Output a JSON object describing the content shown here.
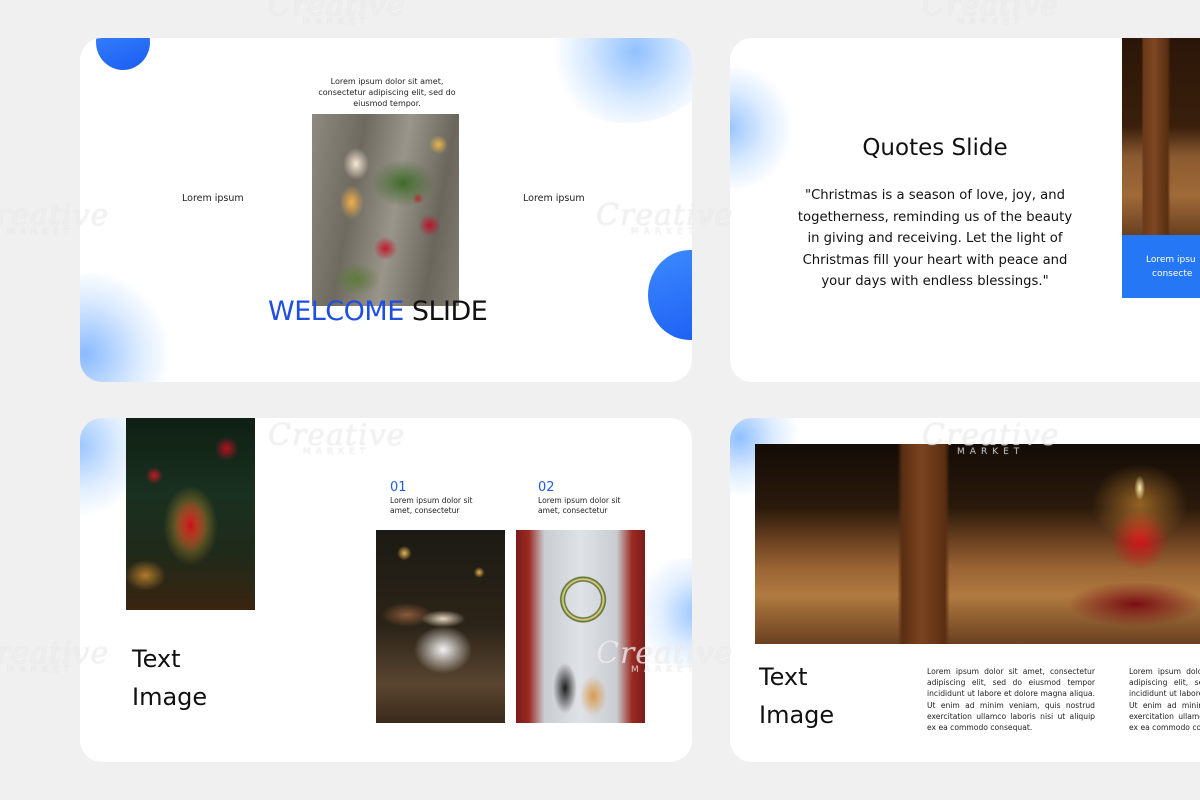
{
  "watermark": {
    "brand": "Creative",
    "sub": "MARKET"
  },
  "slide1": {
    "caption": "Lorem ipsum dolor sit amet, consectetur adipiscing elit, sed do eiusmod tempor.",
    "left_label": "Lorem ipsum",
    "right_label": "Lorem ipsum",
    "title_blue": "WELCOME",
    "title_dark": " SLIDE"
  },
  "slide2": {
    "title": "Quotes Slide",
    "quote": "\"Christmas is a season of love, joy, and togetherness, reminding us of the beauty in giving and receiving. Let the light of Christmas fill your heart with peace and your days with endless blessings.\"",
    "box_text_1": "Lorem ipsu",
    "box_text_2": "consecte"
  },
  "slide3": {
    "heading_line1": "Text",
    "heading_line2": "Image",
    "item1_num": "01",
    "item1_text": "Lorem ipsum dolor sit amet, consectetur",
    "item2_num": "02",
    "item2_text": "Lorem ipsum dolor sit amet, consectetur"
  },
  "slide4": {
    "heading_line1": "Text",
    "heading_line2": "Image",
    "para1": "Lorem ipsum dolor sit amet, consectetur adipiscing elit, sed do eiusmod tempor incididunt ut labore et dolore magna aliqua. Ut enim ad minim veniam, quis nostrud exercitation ullamco laboris nisi ut aliquip ex ea commodo consequat.",
    "para2": "Lorem ipsum dolor sit amet, consectetur adipiscing elit, sed do eiusmod tempor incididunt ut labore et dolore magna aliqua. Ut enim ad minim veniam, quis nostrud exercitation ullamco laboris nisi ut aliquip ex ea commodo consequat."
  },
  "colors": {
    "accent": "#1f5ce6",
    "background": "#f0f0f0",
    "slide": "#ffffff"
  }
}
